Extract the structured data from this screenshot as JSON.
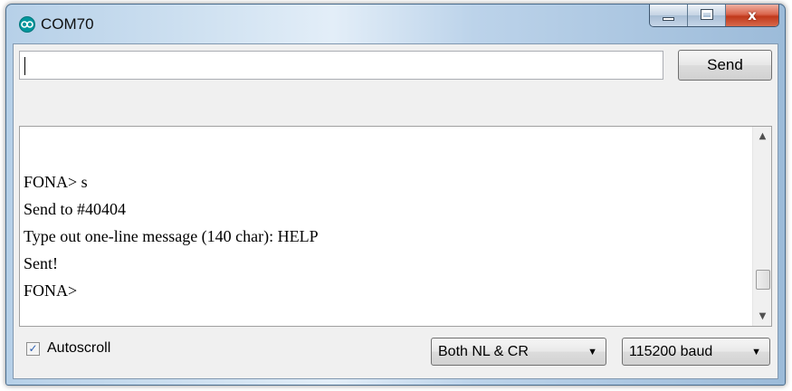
{
  "window": {
    "title": "COM70",
    "controls": {
      "close_glyph": "x"
    }
  },
  "input": {
    "value": "",
    "placeholder": ""
  },
  "toolbar": {
    "send_label": "Send"
  },
  "serial_output": {
    "lines": [
      "FONA> s",
      "Send to #40404",
      "Type out one-line message (140 char): HELP",
      "Sent!",
      "FONA>"
    ]
  },
  "footer": {
    "autoscroll_label": "Autoscroll",
    "autoscroll_checked": true,
    "line_ending": "Both NL & CR",
    "baud_rate": "115200 baud"
  },
  "icons": {
    "app": "arduino-infinity-icon",
    "checkbox": "check-icon",
    "dropdown": "chevron-down-icon",
    "scroll_up": "arrow-up-icon",
    "scroll_down": "arrow-down-icon"
  },
  "colors": {
    "arduino_teal": "#00979d",
    "close_red": "#c0381b",
    "title_glass": "#cfe1f1"
  }
}
